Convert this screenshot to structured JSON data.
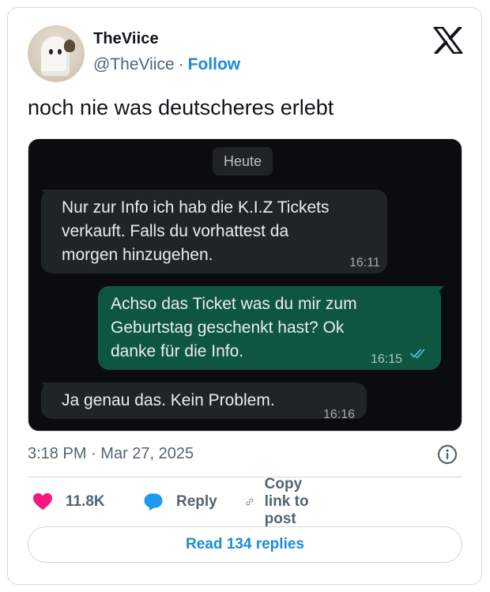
{
  "author": {
    "name": "TheViice",
    "handle": "@TheViice",
    "separator": "·",
    "follow_label": "Follow"
  },
  "platform_logo": "x-logo-icon",
  "tweet": {
    "text": "noch nie was deutscheres erlebt"
  },
  "chat": {
    "date_chip": "Heute",
    "messages": [
      {
        "direction": "incoming",
        "lines": [
          "Nur zur Info ich hab die K.I.Z Tickets",
          "verkauft. Falls du vorhattest da",
          "morgen hinzugehen."
        ],
        "time": "16:11"
      },
      {
        "direction": "outgoing",
        "lines": [
          "Achso das Ticket was du mir zum",
          "Geburtstag geschenkt hast? Ok",
          "danke für die Info."
        ],
        "time": "16:15",
        "status": "read-double-check-icon"
      },
      {
        "direction": "incoming",
        "lines": [
          "Ja genau das. Kein Problem."
        ],
        "time": "16:16"
      }
    ]
  },
  "meta": {
    "time": "3:18 PM",
    "separator": "·",
    "date": "Mar 27, 2025"
  },
  "actions": {
    "like_count": "11.8K",
    "reply_label": "Reply",
    "copy_label": "Copy link to post"
  },
  "read_replies_label": "Read 134 replies",
  "colors": {
    "accent": "#1d8ad8",
    "like": "#f91880",
    "reply": "#1d9bf0",
    "chat_background": "#0b0c0d",
    "incoming_bubble": "#1f2527",
    "outgoing_bubble": "#0f5640"
  }
}
